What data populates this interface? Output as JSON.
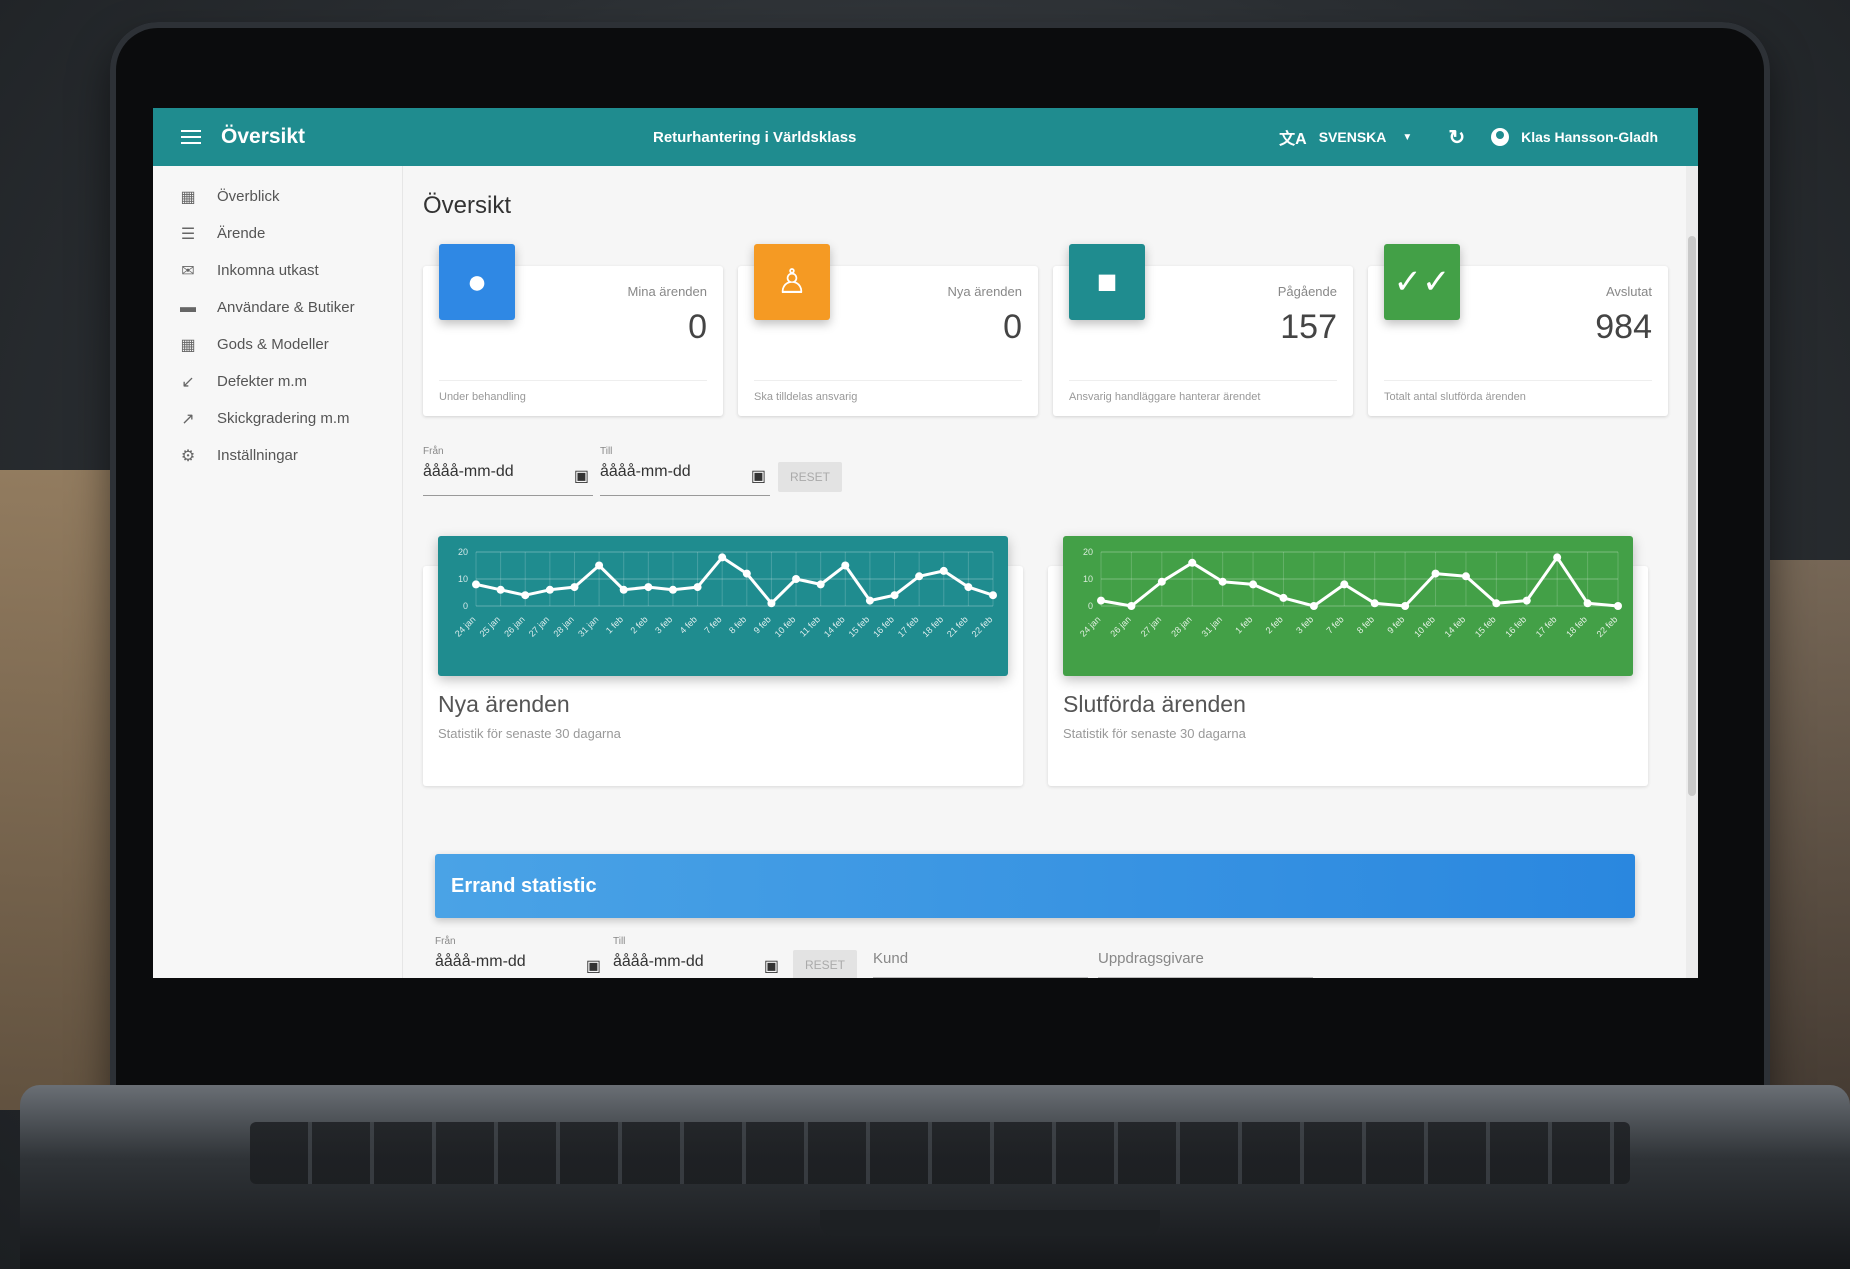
{
  "app": {
    "title": "Översikt",
    "subtitle": "Returhantering i Världsklass",
    "language": "SVENSKA",
    "user": "Klas Hansson-Gladh"
  },
  "sidebar": {
    "items": [
      {
        "label": "Överblick",
        "icon": "dashboard-icon"
      },
      {
        "label": "Ärende",
        "icon": "list-icon"
      },
      {
        "label": "Inkomna utkast",
        "icon": "inbox-icon"
      },
      {
        "label": "Användare & Butiker",
        "icon": "users-icon"
      },
      {
        "label": "Gods & Modeller",
        "icon": "grid-icon"
      },
      {
        "label": "Defekter m.m",
        "icon": "arrow-down-left-icon"
      },
      {
        "label": "Skickgradering m.m",
        "icon": "arrow-up-right-icon"
      },
      {
        "label": "Inställningar",
        "icon": "gear-icon"
      }
    ]
  },
  "page": {
    "title": "Översikt"
  },
  "stats": [
    {
      "label": "Mina ärenden",
      "value": "0",
      "footer": "Under behandling",
      "color": "#2f88e4",
      "icon": "person-icon"
    },
    {
      "label": "Nya ärenden",
      "value": "0",
      "footer": "Ska tilldelas ansvarig",
      "color": "#f59a23",
      "icon": "accessibility-icon"
    },
    {
      "label": "Pågående",
      "value": "157",
      "footer": "Ansvarig handläggare hanterar ärendet",
      "color": "#1f8c8f",
      "icon": "briefcase-icon"
    },
    {
      "label": "Avslutat",
      "value": "984",
      "footer": "Totalt antal slutförda ärenden",
      "color": "#43a047",
      "icon": "done-all-icon"
    }
  ],
  "filters": {
    "from_label": "Från",
    "to_label": "Till",
    "date_placeholder": "åååå-mm-dd",
    "reset": "RESET"
  },
  "errand_filters": {
    "from_label": "Från",
    "to_label": "Till",
    "date_placeholder": "åååå-mm-dd",
    "reset": "RESET",
    "customer": "Kund",
    "client": "Uppdragsgivare"
  },
  "banner": {
    "title": "Errand statistic"
  },
  "chart_data": [
    {
      "type": "line",
      "title": "Nya ärenden",
      "subtitle": "Statistik för senaste 30 dagarna",
      "color": "#1f8c8f",
      "ylim": [
        0,
        20
      ],
      "yticks": [
        0,
        10,
        20
      ],
      "categories": [
        "24 jan",
        "25 jan",
        "26 jan",
        "27 jan",
        "28 jan",
        "31 jan",
        "1 feb",
        "2 feb",
        "3 feb",
        "4 feb",
        "7 feb",
        "8 feb",
        "9 feb",
        "10 feb",
        "11 feb",
        "14 feb",
        "15 feb",
        "16 feb",
        "17 feb",
        "18 feb",
        "21 feb",
        "22 feb"
      ],
      "values": [
        8,
        6,
        4,
        6,
        7,
        15,
        6,
        7,
        6,
        7,
        18,
        12,
        1,
        10,
        8,
        15,
        2,
        4,
        11,
        13,
        7,
        4
      ]
    },
    {
      "type": "line",
      "title": "Slutförda ärenden",
      "subtitle": "Statistik för senaste 30 dagarna",
      "color": "#43a047",
      "ylim": [
        0,
        20
      ],
      "yticks": [
        0,
        10,
        20
      ],
      "categories": [
        "24 jan",
        "26 jan",
        "27 jan",
        "28 jan",
        "31 jan",
        "1 feb",
        "2 feb",
        "3 feb",
        "7 feb",
        "8 feb",
        "9 feb",
        "10 feb",
        "14 feb",
        "15 feb",
        "16 feb",
        "17 feb",
        "18 feb",
        "22 feb"
      ],
      "values": [
        2,
        0,
        9,
        16,
        9,
        8,
        3,
        0,
        8,
        1,
        0,
        12,
        11,
        1,
        2,
        18,
        1,
        0
      ]
    }
  ]
}
